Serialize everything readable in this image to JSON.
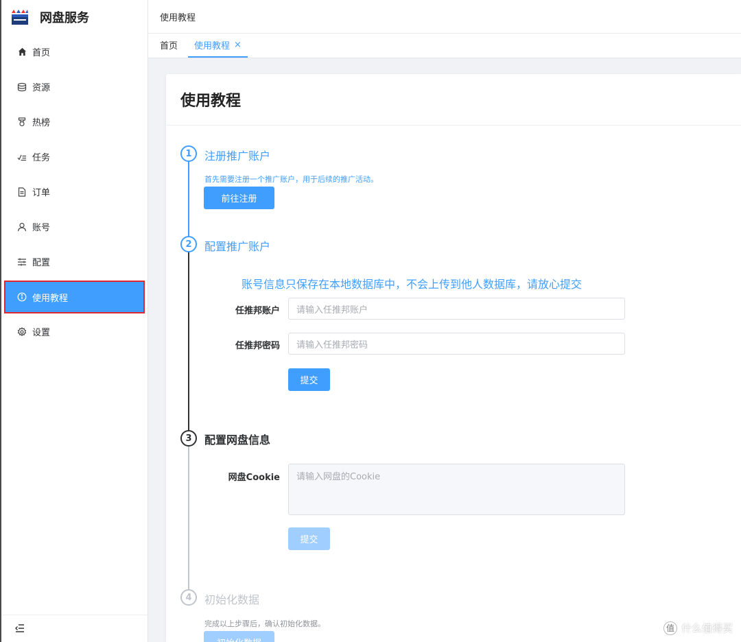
{
  "app": {
    "title": "网盘服务"
  },
  "sidebar": {
    "items": [
      {
        "label": "首页",
        "icon": "home-icon",
        "active": false
      },
      {
        "label": "资源",
        "icon": "database-icon",
        "active": false
      },
      {
        "label": "热榜",
        "icon": "medal-icon",
        "active": false
      },
      {
        "label": "任务",
        "icon": "task-list-icon",
        "active": false
      },
      {
        "label": "订单",
        "icon": "document-icon",
        "active": false
      },
      {
        "label": "账号",
        "icon": "user-icon",
        "active": false
      },
      {
        "label": "配置",
        "icon": "sliders-icon",
        "active": false
      },
      {
        "label": "使用教程",
        "icon": "info-circle-icon",
        "active": true
      },
      {
        "label": "设置",
        "icon": "gear-icon",
        "active": false
      }
    ],
    "collapse_icon": "collapse-menu-icon"
  },
  "header": {
    "breadcrumb": "使用教程"
  },
  "tabs": [
    {
      "label": "首页",
      "active": false
    },
    {
      "label": "使用教程",
      "active": true,
      "close": "×"
    }
  ],
  "page": {
    "title": "使用教程"
  },
  "steps": [
    {
      "number": "1",
      "title": "注册推广账户",
      "desc": "首先需要注册一个推广账户，用于后续的推广活动。",
      "button": "前往注册",
      "state": "active"
    },
    {
      "number": "2",
      "title": "配置推广账户",
      "notice": "账号信息只保存在本地数据库中，不会上传到他人数据库，请放心提交",
      "fields": [
        {
          "label": "任推邦账户",
          "placeholder": "请输入任推邦账户"
        },
        {
          "label": "任推邦密码",
          "placeholder": "请输入任推邦密码"
        }
      ],
      "button": "提交",
      "state": "active"
    },
    {
      "number": "3",
      "title": "配置网盘信息",
      "field": {
        "label": "网盘Cookie",
        "placeholder": "请输入网盘的Cookie"
      },
      "button": "提交",
      "state": "current"
    },
    {
      "number": "4",
      "title": "初始化数据",
      "desc": "完成以上步骤后，确认初始化数据。",
      "button": "初始化数据",
      "state": "pending"
    }
  ],
  "colors": {
    "primary": "#409eff",
    "primary_light": "#a0cfff",
    "pending": "#c0c4cc",
    "current": "#303133",
    "highlight_border": "#e2262e"
  },
  "watermark": {
    "badge": "值",
    "text": "什么值得买"
  }
}
